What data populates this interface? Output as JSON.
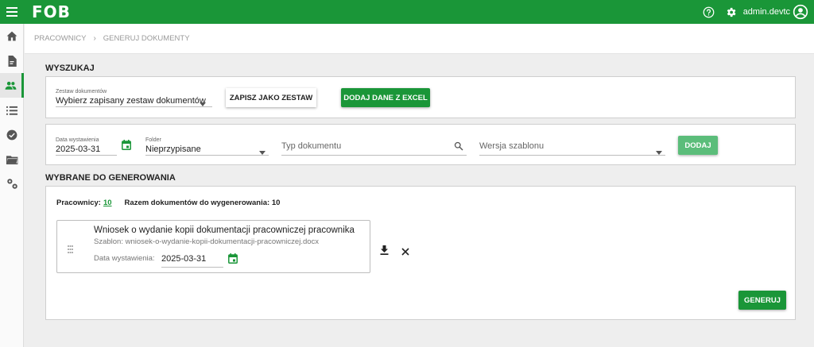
{
  "app": {
    "logo": "FOB",
    "username": "admin.devtc"
  },
  "breadcrumb": {
    "items": [
      "PRACOWNICY",
      "GENERUJ DOKUMENTY"
    ]
  },
  "search": {
    "title": "WYSZUKAJ",
    "document_set": {
      "label": "Zestaw dokumentów",
      "value": "Wybierz zapisany zestaw dokumentów"
    },
    "save_set_label": "ZAPISZ JAKO ZESTAW",
    "add_excel_label": "DODAJ DANE Z EXCEL",
    "issue_date": {
      "label": "Data wystawienia",
      "value": "2025-03-31"
    },
    "folder": {
      "label": "Folder",
      "value": "Nieprzypisane"
    },
    "doc_type": {
      "placeholder": "Typ dokumentu"
    },
    "template_version": {
      "placeholder": "Wersja szablonu"
    },
    "add_label": "DODAJ"
  },
  "selected": {
    "title": "WYBRANE DO GENEROWANIA",
    "employees_label": "Pracownicy:",
    "employees_count": "10",
    "total_label": "Razem dokumentów do wygenerowania: 10",
    "document": {
      "title": "Wniosek o wydanie kopii dokumentacji pracowniczej pracownika",
      "template": "Szablon: wniosek-o-wydanie-kopii-dokumentacji-pracowniczej.docx",
      "date_label": "Data wystawienia:",
      "date_value": "2025-03-31"
    },
    "generate_label": "GENERUJ"
  },
  "colors": {
    "brand": "#1a9638",
    "brand_light": "#5bbd7a"
  },
  "icons": [
    "menu-icon",
    "help-icon",
    "gear-icon",
    "account-icon",
    "home-icon",
    "document-icon",
    "people-icon",
    "list-icon",
    "check-circle-icon",
    "folder-icon",
    "settings-icon",
    "dropdown-arrow-icon",
    "calendar-icon",
    "search-icon",
    "drag-handle-icon",
    "download-icon",
    "close-icon"
  ]
}
